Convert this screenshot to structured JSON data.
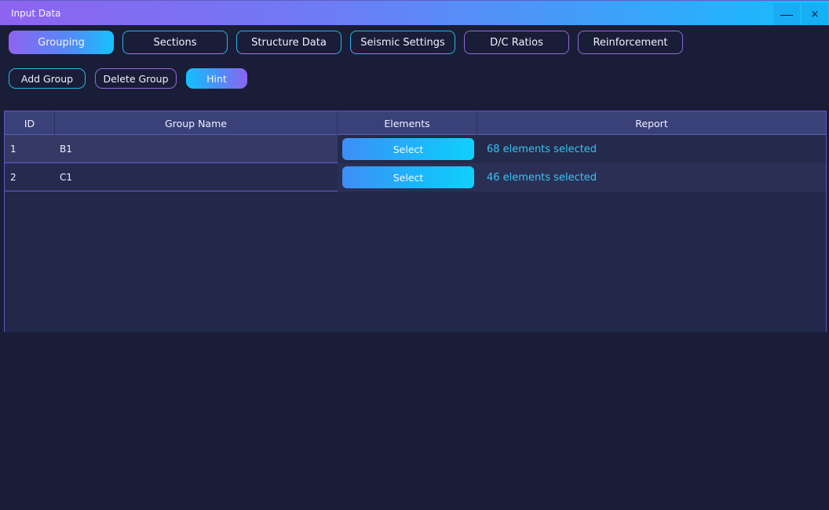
{
  "window": {
    "title": "Input Data",
    "minimize_label": "—",
    "close_label": "×"
  },
  "tabs": [
    {
      "label": "Grouping",
      "active": true
    },
    {
      "label": "Sections"
    },
    {
      "label": "Structure Data"
    },
    {
      "label": "Seismic Settings"
    },
    {
      "label": "D/C Ratios"
    },
    {
      "label": "Reinforcement"
    }
  ],
  "toolbar": {
    "add_group_label": "Add Group",
    "delete_group_label": "Delete Group",
    "hint_label": "Hint"
  },
  "table": {
    "columns": [
      "ID",
      "Group Name",
      "Elements",
      "Report"
    ],
    "rows": [
      {
        "id": "1",
        "group_name": "B1",
        "elements_button": "Select",
        "report": "68 elements selected"
      },
      {
        "id": "2",
        "group_name": "C1",
        "elements_button": "Select",
        "report": "46 elements selected"
      }
    ]
  },
  "colors": {
    "background": "#1a1d37",
    "accent_cyan": "#12c0fc",
    "accent_violet": "#8e63f0",
    "report_text": "#36c4f2"
  },
  "icons": {
    "minimize": "minimize-icon",
    "close": "close-icon"
  }
}
